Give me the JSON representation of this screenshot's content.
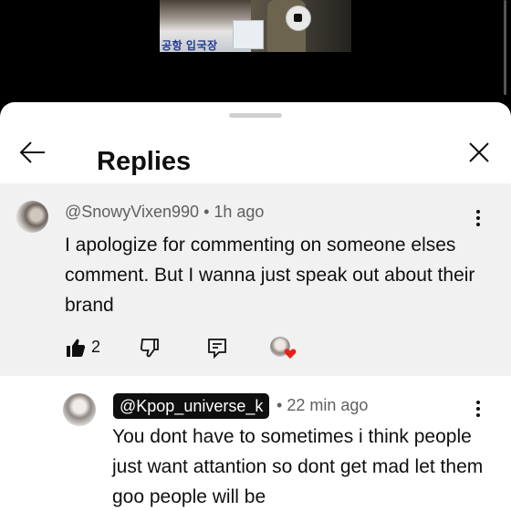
{
  "video": {
    "sign_text": "공항 입국장"
  },
  "sheet": {
    "title": "Replies"
  },
  "parent_comment": {
    "author": "@SnowyVixen990",
    "time": "1h ago",
    "text": "I apologize for commenting on someone elses comment. But I wanna just speak out about their brand",
    "like_count": "2"
  },
  "reply": {
    "author": "@Kpop_universe_k",
    "time": "22 min ago",
    "text": "You dont have to sometimes i think people just want attantion so dont get mad let them goo people will be"
  },
  "colors": {
    "heart": "#e62117",
    "chip_bg": "#0f0f0f",
    "parent_bg": "#f1f1f1"
  }
}
